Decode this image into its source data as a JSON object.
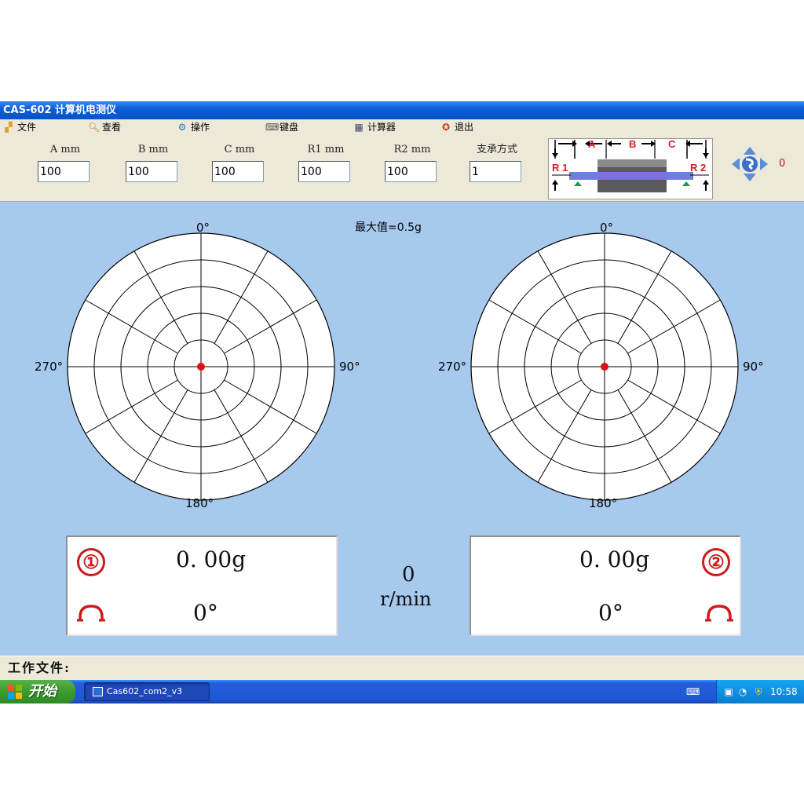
{
  "window": {
    "title": "CAS-602 计算机电测仪"
  },
  "menu": [
    {
      "label": "文件",
      "icon": "folder-icon"
    },
    {
      "label": "查看",
      "icon": "magnifier-icon"
    },
    {
      "label": "操作",
      "icon": "gear-icon"
    },
    {
      "label": "键盘",
      "icon": "keyboard-icon"
    },
    {
      "label": "计算器",
      "icon": "calculator-icon"
    },
    {
      "label": "退出",
      "icon": "exit-icon"
    }
  ],
  "params": [
    {
      "label": "A mm",
      "value": "100"
    },
    {
      "label": "B mm",
      "value": "100"
    },
    {
      "label": "C mm",
      "value": "100"
    },
    {
      "label": "R1 mm",
      "value": "100"
    },
    {
      "label": "R2 mm",
      "value": "100"
    },
    {
      "label": "支承方式",
      "value": "1"
    }
  ],
  "diagram": {
    "labels": {
      "a": "A",
      "b": "B",
      "c": "C",
      "r1": "R 1",
      "r2": "R 2"
    },
    "colors": {
      "label": "#d42020",
      "rotor": "#5a5a5a",
      "shaft": "#6f7fd8",
      "support": "#1a9a4a"
    }
  },
  "nav": {
    "value": "0"
  },
  "main": {
    "max_label": "最大值=0.5g",
    "angles": {
      "top": "0°",
      "right": "90°",
      "bottom": "180°",
      "left": "270°"
    },
    "plane1": {
      "badge": "①",
      "amplitude": "0. 00g",
      "phase": "0°"
    },
    "plane2": {
      "badge": "②",
      "amplitude": "0. 00g",
      "phase": "0°"
    },
    "speed": {
      "value": "0",
      "unit": "r/min"
    }
  },
  "status": {
    "label": "工作文件:"
  },
  "taskbar": {
    "start_label": "开始",
    "task_label": "Cas602_com2_v3",
    "clock": "10:58"
  },
  "colors": {
    "accent_red": "#cc1b1b",
    "plot_bg": "#a7c9ee",
    "title_blue": "#0a5fd8",
    "dot": "#e01010"
  }
}
